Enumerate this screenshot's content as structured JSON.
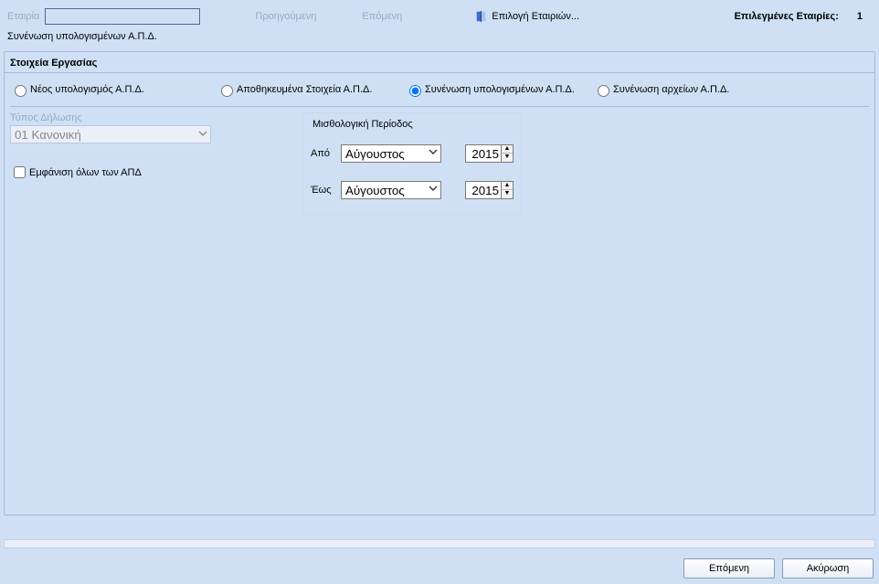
{
  "topbar": {
    "company_label": "Εταιρία",
    "company_value": "",
    "prev": "Προηγούμενη",
    "next": "Επόμενη",
    "select_companies": "Επιλογή Εταιριών...",
    "selected_label": "Επιλεγμένες Εταιρίες:",
    "selected_count": "1"
  },
  "subtitle": "Συνένωση υπολογισμένων Α.Π.Δ.",
  "panel": {
    "title": "Στοιχεία Εργασίας",
    "radios": {
      "r1": "Νέος υπολογισμός Α.Π.Δ.",
      "r2": "Αποθηκευμένα Στοιχεία Α.Π.Δ.",
      "r3": "Συνένωση υπολογισμένων Α.Π.Δ.",
      "r4": "Συνένωση αρχείων Α.Π.Δ."
    },
    "type_label": "Τύπος Δήλωσης",
    "type_value": "01 Κανονική",
    "show_all_apd": "Εμφάνιση όλων των ΑΠΔ",
    "period": {
      "title": "Μισθολογική Περίοδος",
      "from_label": "Από",
      "to_label": "Έως",
      "from_month": "Αύγουστος",
      "to_month": "Αύγουστος",
      "from_year": "2015",
      "to_year": "2015"
    }
  },
  "buttons": {
    "next": "Επόμενη",
    "cancel": "Ακύρωση"
  }
}
